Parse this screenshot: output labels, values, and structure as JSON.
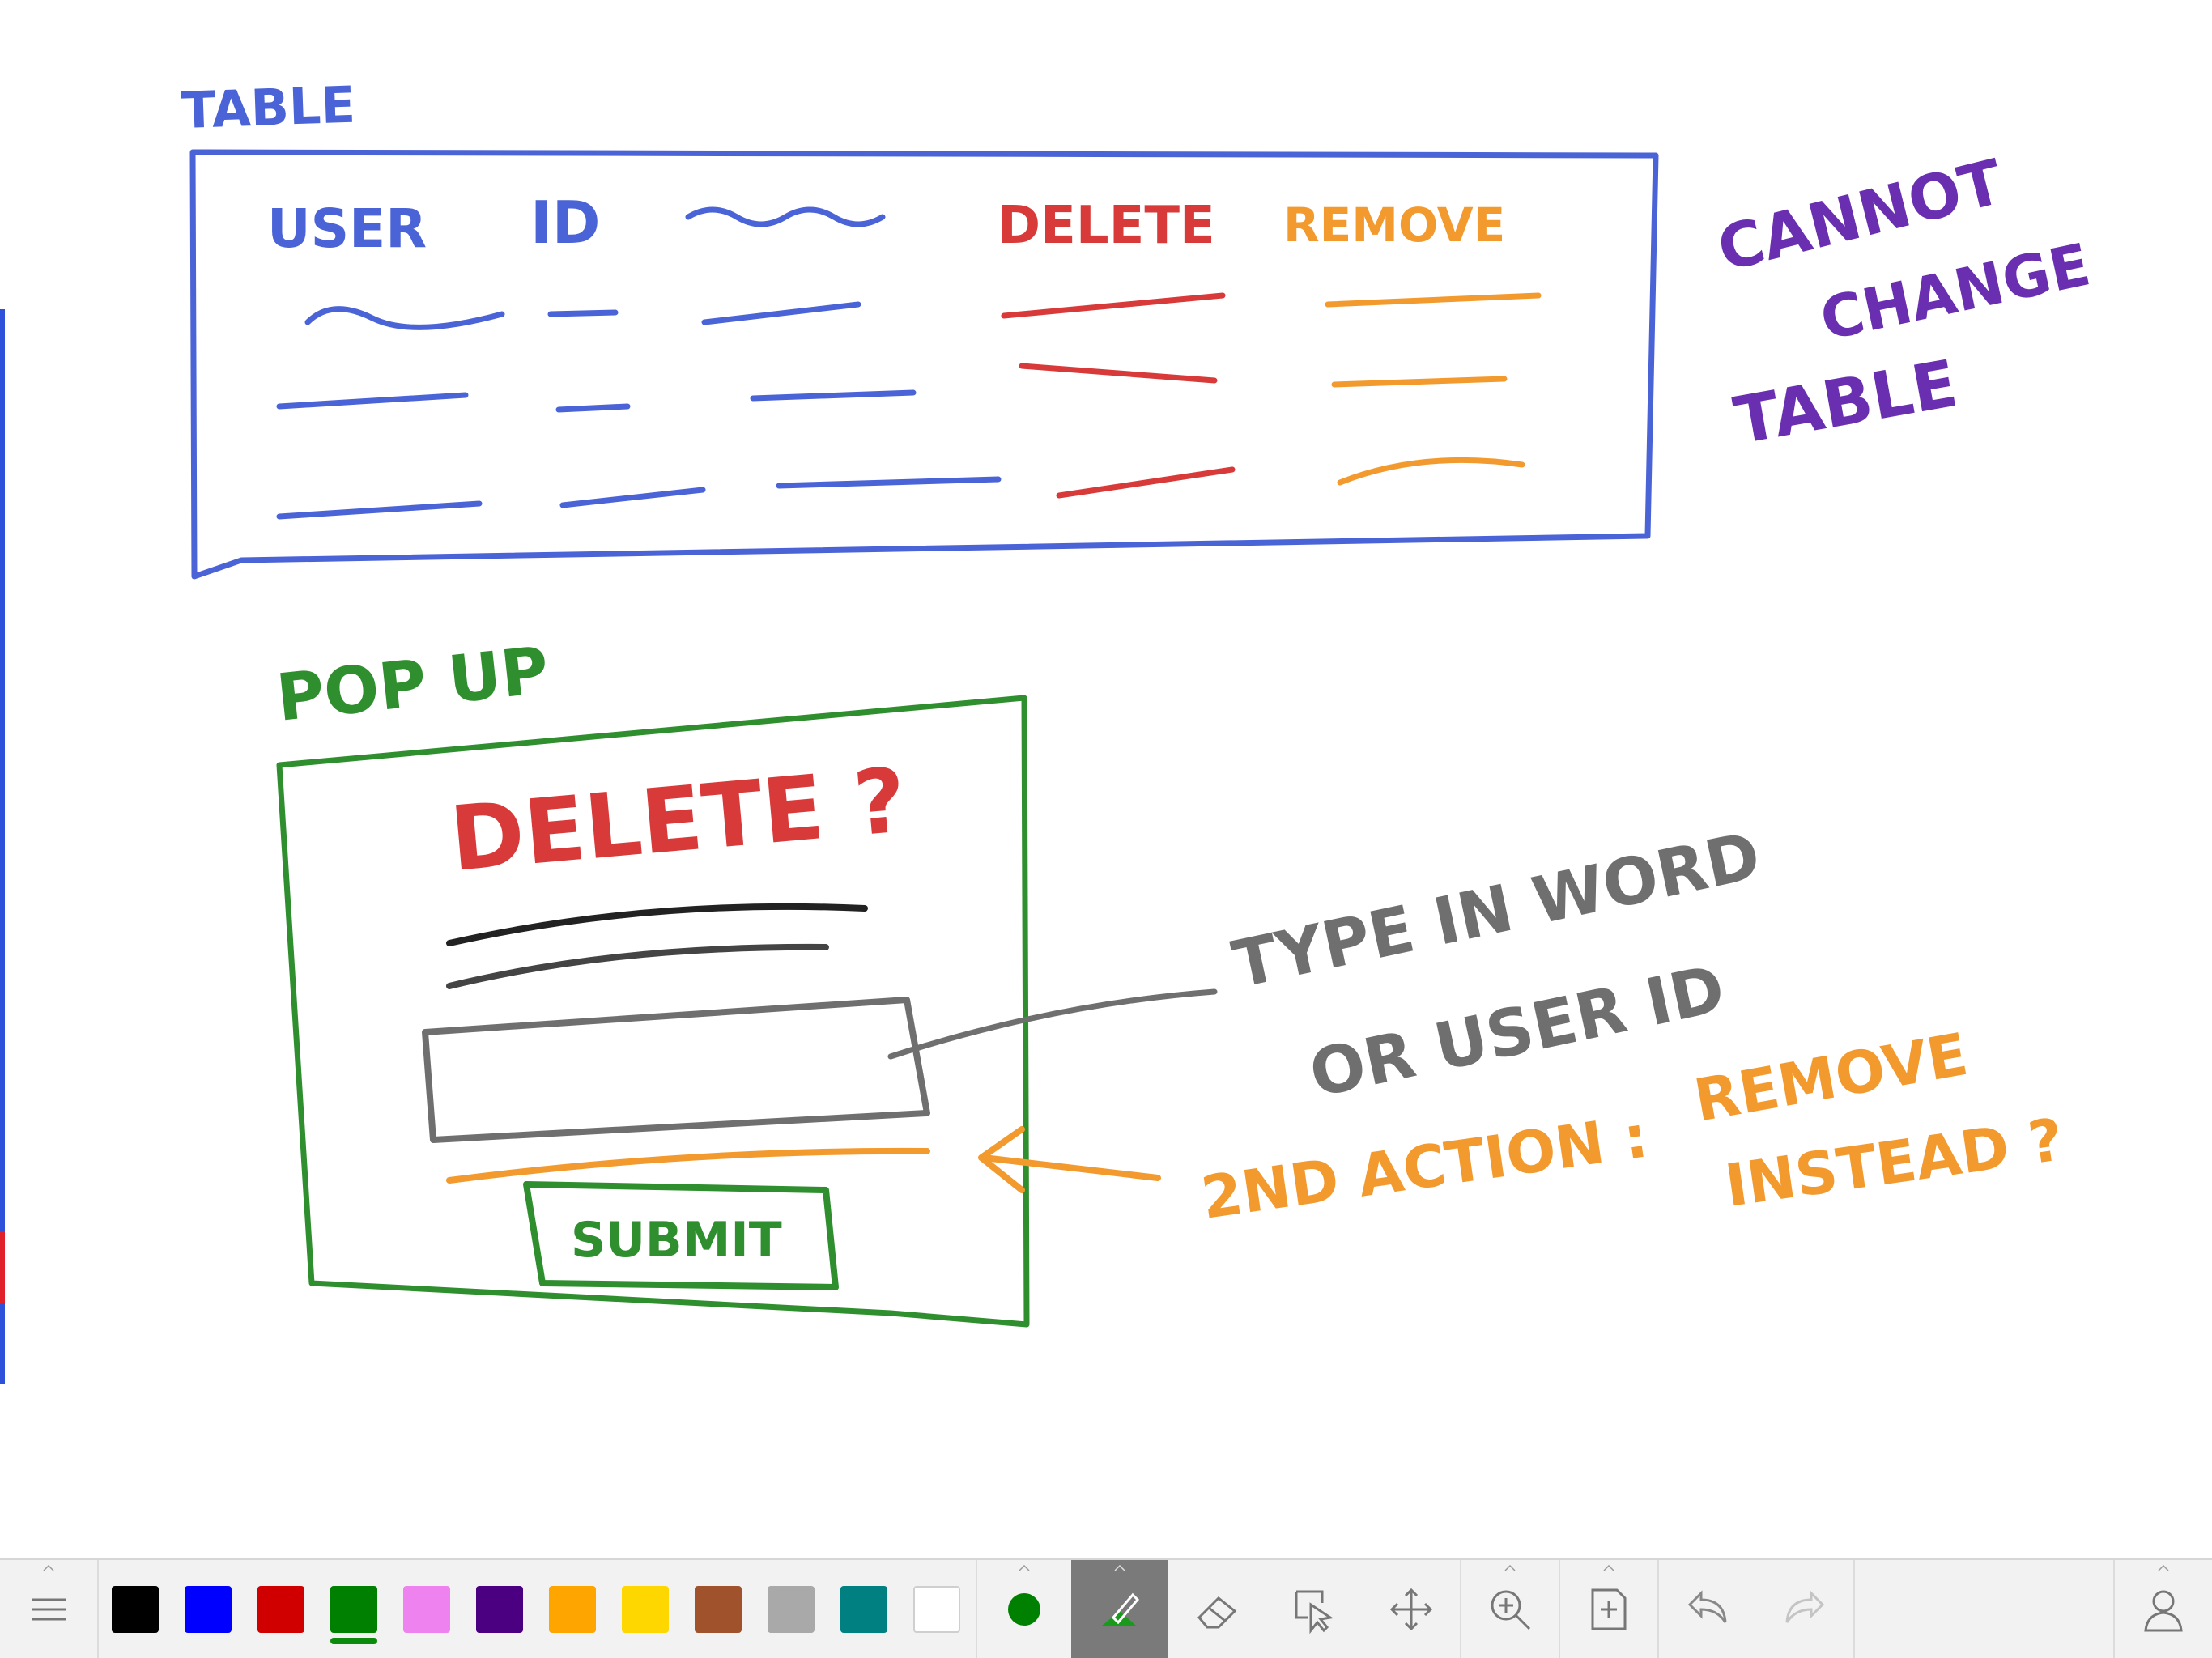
{
  "sketch": {
    "table_title": "TABLE",
    "table_headers": [
      "USER",
      "ID",
      "DELETE",
      "REMOVE"
    ],
    "side_note": [
      "CANNOT",
      "CHANGE",
      "TABLE"
    ],
    "popup_title": "POP UP",
    "popup_heading": "DELETE ?",
    "submit_label": "SUBMIT",
    "annotation_type": [
      "TYPE IN WORD",
      "OR USER ID"
    ],
    "annotation_action": [
      "2ND ACTION :",
      "REMOVE",
      "INSTEAD ?"
    ],
    "ink_colors": {
      "blue": "#4a63d6",
      "red": "#d83a3a",
      "orange": "#f39a2e",
      "purple": "#6a2fb0",
      "green": "#2f8f2f",
      "gray": "#6f6f6f"
    }
  },
  "toolbar": {
    "menu_icon": "menu-icon",
    "colors": [
      "#000000",
      "#0000ff",
      "#d00000",
      "#008000",
      "#ee82ee",
      "#4b0082",
      "#ffa500",
      "#ffd700",
      "#a0522d",
      "#a9a9a9",
      "#008080",
      "#ffffff"
    ],
    "selected_color_index": 3,
    "current_color": "#008000",
    "tools": [
      "pen-icon",
      "eraser-icon",
      "select-icon",
      "move-icon",
      "zoom-icon",
      "add-page-icon",
      "undo-icon",
      "redo-icon"
    ],
    "active_tool": "pen-icon",
    "account_icon": "user-icon"
  }
}
